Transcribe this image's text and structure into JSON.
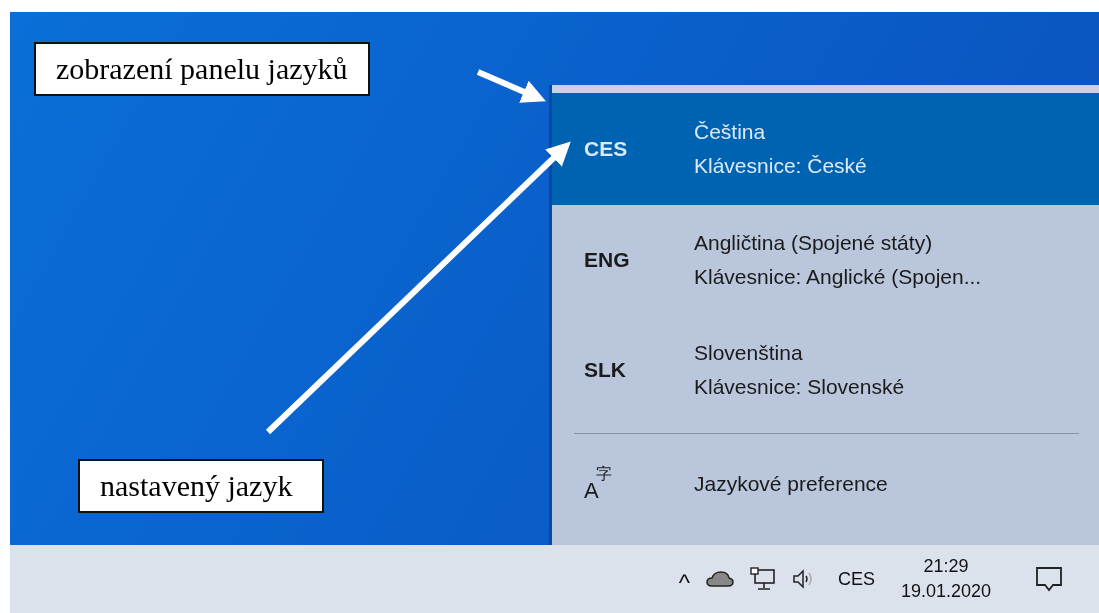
{
  "annotations": [
    {
      "text": "zobrazení panelu jazyků"
    },
    {
      "text": "nastavený jazyk"
    }
  ],
  "language_menu": {
    "languages": [
      {
        "code": "CES",
        "name": "Čeština",
        "keyboard": "Klávesnice: České",
        "selected": true
      },
      {
        "code": "ENG",
        "name": "Angličtina (Spojené státy)",
        "keyboard": "Klávesnice: Anglické (Spojen...",
        "selected": false
      },
      {
        "code": "SLK",
        "name": "Slovenština",
        "keyboard": "Klávesnice: Slovenské",
        "selected": false
      }
    ],
    "preferences": {
      "icon_glyphs": [
        "A",
        "字"
      ],
      "label": "Jazykové preference"
    }
  },
  "taskbar": {
    "chevron": "^",
    "language": "CES",
    "time": "21:29",
    "date": "19.01.2020"
  }
}
